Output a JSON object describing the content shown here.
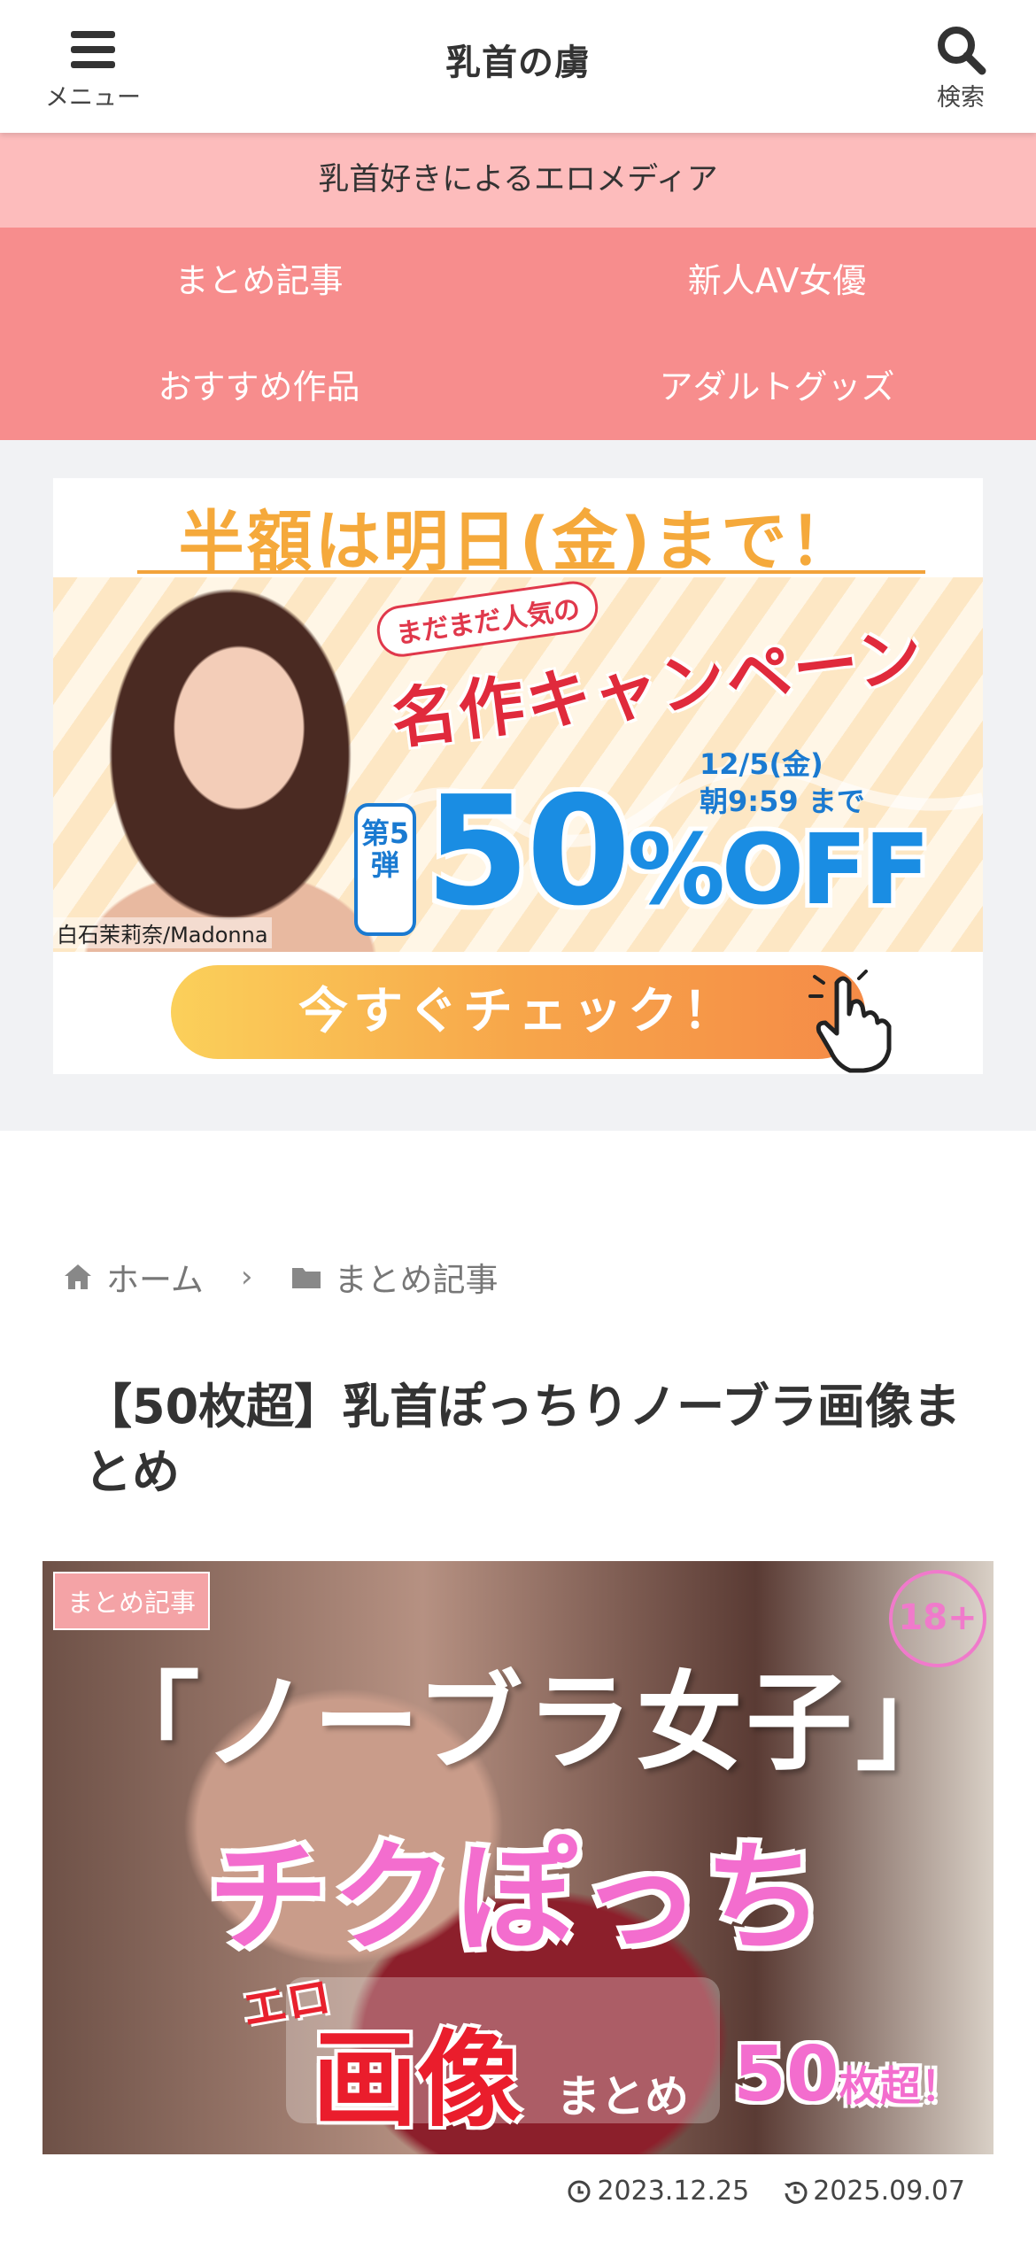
{
  "header": {
    "site_title": "乳首の虜",
    "menu_label": "メニュー",
    "search_label": "検索"
  },
  "tagline": "乳首好きによるエロメディア",
  "nav": {
    "items": [
      {
        "label": "まとめ記事"
      },
      {
        "label": "新人AV女優"
      },
      {
        "label": "おすすめ作品"
      },
      {
        "label": "アダルトグッズ"
      }
    ]
  },
  "banner": {
    "headline": "半額は明日(金)まで！",
    "campaign_pre": "まだまだ人気の",
    "campaign_title": "名作キャンペーン",
    "deadline_date": "12/5(金)",
    "deadline_time": "朝9:59 まで",
    "round_badge": "第5弾",
    "discount_value": "50",
    "discount_unit": "%OFF",
    "credit": "白石茉莉奈/Madonna",
    "cta": "今すぐチェック！"
  },
  "breadcrumb": {
    "home": "ホーム",
    "category": "まとめ記事"
  },
  "post": {
    "title": "【50枚超】乳首ぽっちりノーブラ画像まとめ",
    "eyecatch": {
      "category_label": "まとめ記事",
      "age_badge": "18+",
      "line1": "「ノーブラ女子」",
      "line2": "チクぽっち",
      "ero": "エロ",
      "gazou": "画像",
      "matome": "まとめ",
      "count": "50",
      "count_suffix": "枚超！"
    },
    "published": "2023.12.25",
    "updated": "2025.09.07"
  },
  "colors": {
    "tagline_bg": "#fdbcbc",
    "nav_bg": "#f78d8d",
    "page_grey": "#f1f2f4"
  },
  "icons": [
    "bars-icon",
    "search-icon",
    "home-icon",
    "folder-icon",
    "clock-icon",
    "history-icon"
  ]
}
